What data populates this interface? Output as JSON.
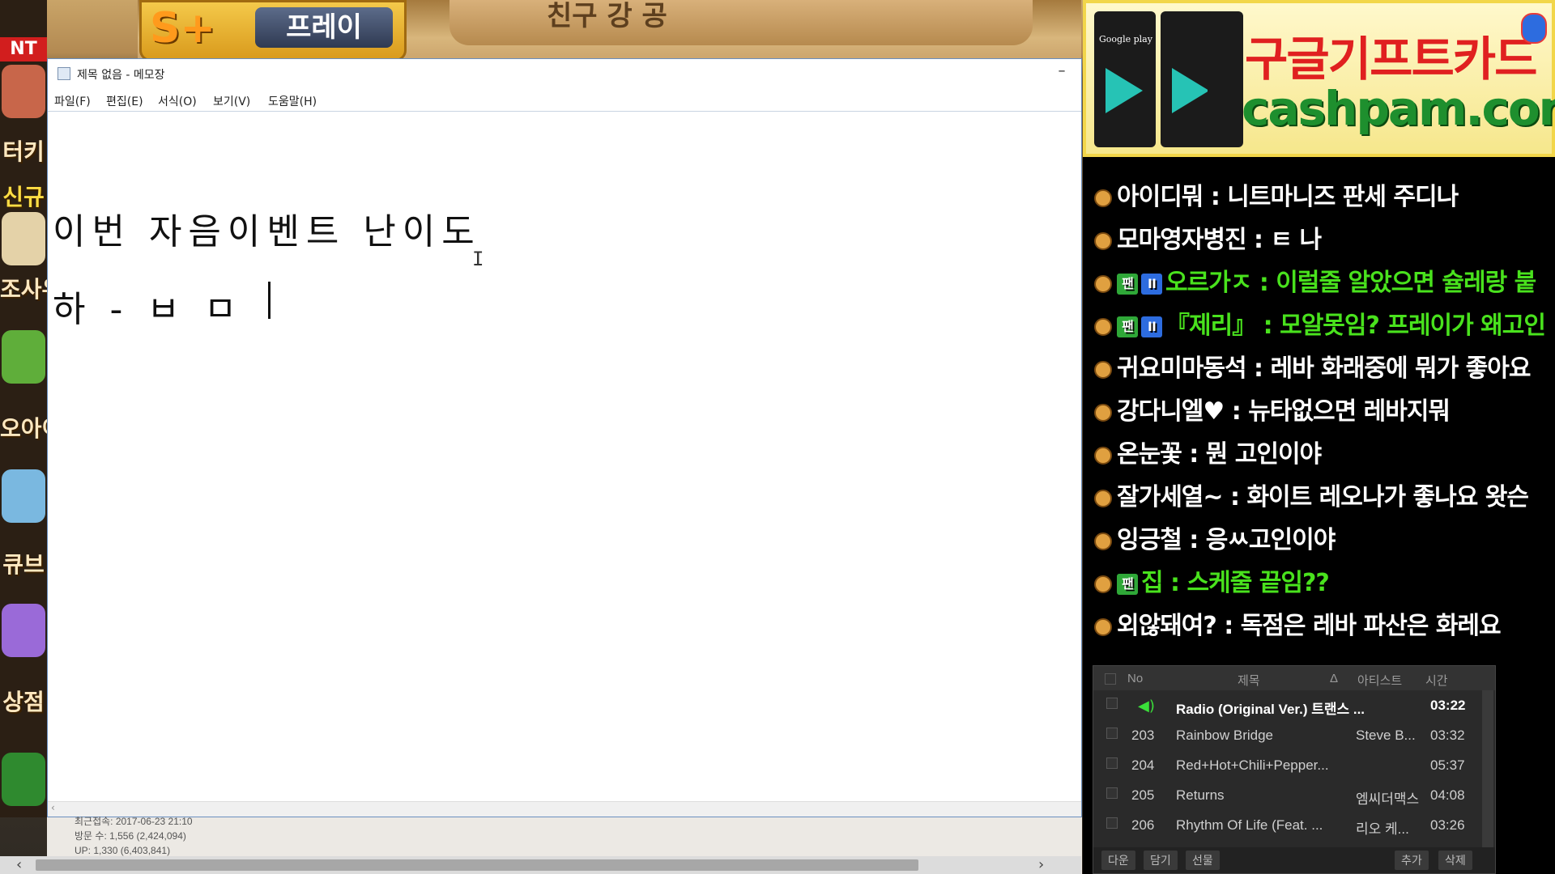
{
  "game": {
    "splus_text": "S+",
    "splus_label": "프레이",
    "ribbon_text": "친구 강 공",
    "sidebar": [
      {
        "label": "터키"
      },
      {
        "label": "신규"
      },
      {
        "label": "조사우"
      },
      {
        "label": "오아이"
      },
      {
        "label": "큐브"
      },
      {
        "label": "상점"
      }
    ],
    "sidebar_top_badge": "NT N",
    "visit_info": [
      "최근접속: 2017-06-23 21:10",
      "방문 수: 1,556 (2,424,094)",
      "UP: 1,330 (6,403,841)"
    ]
  },
  "notepad": {
    "title": "제목 없음 - 메모장",
    "minimize": "–",
    "menu": [
      "파일(F)",
      "편집(E)",
      "서식(O)",
      "보기(V)",
      "도움말(H)"
    ],
    "lines": [
      "이번 자음이벤트 난이도",
      "하 - ㅂ ㅁ"
    ],
    "ibeam": "I"
  },
  "ad": {
    "title": "구글기프트카드",
    "url": "cashpam.com",
    "card_label": "Google play"
  },
  "chat": [
    {
      "user": "아이디뭐",
      "msg": "니트마니즈 판세 주디나",
      "green": false,
      "fan": false,
      "sub": false
    },
    {
      "user": "모마영자병진",
      "msg": "ㅌ 나",
      "green": false,
      "fan": false,
      "sub": false
    },
    {
      "user": "오르가ㅈ",
      "msg": "이럴줄 알았으면 슐레랑 붙",
      "green": true,
      "fan": true,
      "sub": true
    },
    {
      "user": "『제리』",
      "msg": "모알못임? 프레이가 왜고인",
      "green": true,
      "fan": true,
      "sub": true
    },
    {
      "user": "귀요미마동석",
      "msg": "레바 화래중에 뭐가 좋아요",
      "green": false,
      "fan": false,
      "sub": false
    },
    {
      "user": "강다니엘♥",
      "msg": "뉴타없으면 레바지뭐",
      "green": false,
      "fan": false,
      "sub": false
    },
    {
      "user": "온눈꽃",
      "msg": "뭔 고인이야",
      "green": false,
      "fan": false,
      "sub": false
    },
    {
      "user": "잘가세열~",
      "msg": "화이트 레오나가 좋나요 왓슨",
      "green": false,
      "fan": false,
      "sub": false
    },
    {
      "user": "잉긍철",
      "msg": "응ㅆ고인이야",
      "green": false,
      "fan": false,
      "sub": false
    },
    {
      "user": "집",
      "msg": "스케줄 끝임??",
      "green": true,
      "fan": true,
      "sub": false
    },
    {
      "user": "외않돼여?",
      "msg": "독점은 레바 파산은 화레요",
      "green": false,
      "fan": false,
      "sub": false
    }
  ],
  "player": {
    "headers": {
      "no": "No",
      "title": "제목",
      "sort": "Δ",
      "artist": "아티스트",
      "time": "시간"
    },
    "rows": [
      {
        "no": "",
        "title": "Radio (Original Ver.) 트랜스 ...",
        "artist": "",
        "time": "03:22",
        "active": true
      },
      {
        "no": "203",
        "title": "Rainbow Bridge",
        "artist": "Steve B...",
        "time": "03:32",
        "active": false
      },
      {
        "no": "204",
        "title": "Red+Hot+Chili+Pepper...",
        "artist": "",
        "time": "05:37",
        "active": false
      },
      {
        "no": "205",
        "title": "Returns",
        "artist": "엠씨더맥스",
        "time": "04:08",
        "active": false
      },
      {
        "no": "206",
        "title": "Rhythm Of Life (Feat. ...",
        "artist": "리오 케...",
        "time": "03:26",
        "active": false
      }
    ],
    "buttons": [
      "다운",
      "담기",
      "선물",
      "추가",
      "삭제"
    ]
  }
}
